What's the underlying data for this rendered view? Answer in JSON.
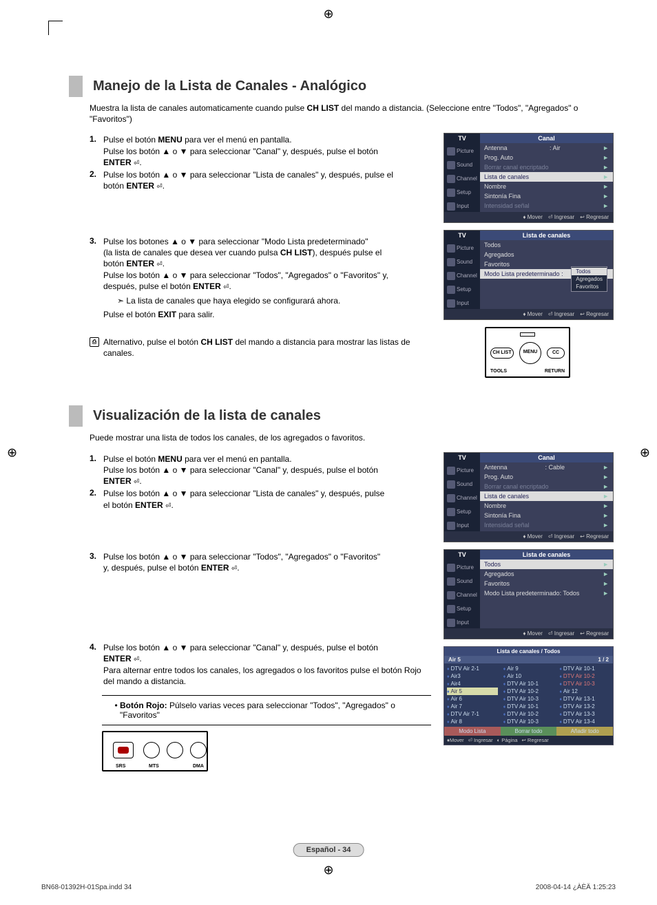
{
  "sections": [
    {
      "title": "Manejo de la Lista de Canales - Analógico",
      "intro_a": "Muestra la lista de canales automaticamente cuando pulse",
      "intro_bold": "CH LIST",
      "intro_b": "del mando a distancia. (Seleccione entre \"Todos\", \"Agregados\" o \"Favoritos\")",
      "steps": [
        {
          "num": "1.",
          "line1a": "Pulse el botón",
          "line1b": "MENU",
          "line1c": "para ver el menú en pantalla.",
          "line2": "Pulse los botón ▲ o ▼ para seleccionar \"Canal\" y, después, pulse el botón",
          "enter": "ENTER"
        },
        {
          "num": "2.",
          "line1": "Pulse los botón ▲ o ▼ para seleccionar \"Lista de canales\" y, después, pulse el",
          "line2a": "botón",
          "enter": "ENTER"
        },
        {
          "num": "3.",
          "line1": "Pulse los botones ▲ o ▼ para seleccionar \"Modo Lista predeterminado\"",
          "line2a": "(la lista de canales que desea ver cuando pulsa ",
          "chlist": "CH LIST",
          "line2b": "), después pulse el",
          "line3a": "botón",
          "enter": "ENTER",
          "line4": "Pulse los botón ▲ o ▼ para seleccionar \"Todos\", \"Agregados\" o \"Favoritos\" y,",
          "line5a": "después, pulse el botón",
          "arrow": "La lista de canales que haya elegido se configurará ahora.",
          "exit_a": "Pulse el botón",
          "exit_b": "EXIT",
          "exit_c": "para salir."
        }
      ],
      "alt": {
        "a": "Alternativo, pulse el botón",
        "bold": "CH LIST",
        "b": "del mando a distancia para mostrar las listas de canales."
      }
    },
    {
      "title": "Visualización de la lista de canales",
      "intro": "Puede mostrar una lista de todos los canales, de los agregados o favoritos.",
      "steps": [
        {
          "num": "1.",
          "l1a": "Pulse el botón",
          "l1b": "MENU",
          "l1c": "para ver el menú en pantalla.",
          "l2": "Pulse los botón ▲ o ▼ para seleccionar \"Canal\" y, después, pulse el botón",
          "enter": "ENTER"
        },
        {
          "num": "2.",
          "l1": "Pulse los botón ▲ o ▼ para seleccionar \"Lista de canales\" y, después, pulse",
          "l2a": "el botón",
          "enter": "ENTER"
        },
        {
          "num": "3.",
          "l1": "Pulse los botón ▲ o ▼ para seleccionar \"Todos\", \"Agregados\" o \"Favoritos\"",
          "l2a": "y, después, pulse el botón",
          "enter": "ENTER"
        },
        {
          "num": "4.",
          "l1": "Pulse los botón ▲ o ▼ para seleccionar \"Canal\" y, después, pulse el botón",
          "enter": "ENTER",
          "l3": "Para alternar entre todos los canales, los agregados o los favoritos pulse el botón Rojo del mando a distancia."
        }
      ],
      "note": {
        "bold": "Botón Rojo:",
        "text": "Púlselo varias veces para seleccionar \"Todos\", \"Agregados\" o \"Favoritos\""
      }
    }
  ],
  "menus": {
    "labels": {
      "tv": "TV",
      "canal": "Canal",
      "lista": "Lista de canales"
    },
    "side": [
      "Picture",
      "Sound",
      "Channel",
      "Setup",
      "Input"
    ],
    "foot": {
      "mover": "Mover",
      "ingresar": "Ingresar",
      "regresar": "Regresar"
    },
    "menu1": {
      "r0": {
        "k": "Antenna",
        "v": ": Air"
      },
      "r1": "Prog. Auto",
      "r2": "Borrar canal encriptado",
      "r3": "Lista de canales",
      "r4": "Nombre",
      "r5": "Sintonía Fina",
      "r6": "Intensidad señal"
    },
    "menu2": {
      "r0": "Todos",
      "r1": "Agregados",
      "r2": "Favoritos",
      "r3": "Modo Lista predeterminado :",
      "popup": [
        "Todos",
        "Agregados",
        "Favoritos"
      ]
    },
    "menu3": {
      "r0": {
        "k": "Antenna",
        "v": ": Cable"
      },
      "r1": "Prog. Auto",
      "r2": "Borrar canal encriptado",
      "r3": "Lista de canales",
      "r4": "Nombre",
      "r5": "Sintonía Fina",
      "r6": "Intensidad señal"
    },
    "menu4": {
      "r0": "Todos",
      "r1": "Agregados",
      "r2": "Favoritos",
      "r3": "Modo Lista predeterminado: Todos"
    }
  },
  "remote1": {
    "chlist": "CH LIST",
    "menu": "MENU",
    "cc": "CC",
    "tools": "TOOLS",
    "return": "RETURN"
  },
  "remote2": {
    "srs": "SRS",
    "mts": "MTS",
    "dma": "DMA"
  },
  "chlist": {
    "title": "Lista de canales / Todos",
    "current": "Air 5",
    "page": "1 / 2",
    "col1": [
      "DTV Air 2-1",
      "Air3",
      "Air4",
      "Air 5",
      "Air 6",
      "Air 7",
      "DTV Air 7-1",
      "Air 8"
    ],
    "col2": [
      "Air 9",
      "Air 10",
      "DTV Air 10-1",
      "DTV Air 10-2",
      "DTV Air 10-3",
      "DTV Air 10-1",
      "DTV Air 10-2",
      "DTV Air 10-3"
    ],
    "col3": [
      "DTV Air 10-1",
      "DTV Air 10-2",
      "DTV Air 10-3",
      "Air 12",
      "DTV Air 13-1",
      "DTV Air 13-2",
      "DTV Air 13-3",
      "DTV Air 13-4"
    ],
    "btns": [
      "Modo Lista",
      "Borrar todo",
      "Añadir todo"
    ],
    "foot": [
      "Mover",
      "Ingresar",
      "Página",
      "Regresar"
    ]
  },
  "footer": {
    "page": "Español - 34",
    "file": "BN68-01392H-01Spa.indd   34",
    "stamp": "2008-04-14   ¿ÀÈÄ 1:25:23"
  }
}
